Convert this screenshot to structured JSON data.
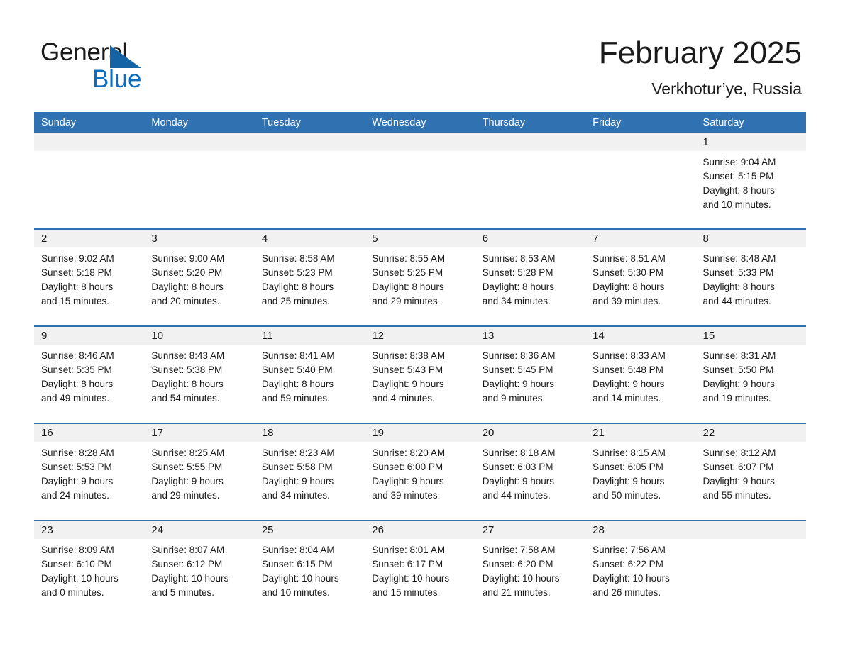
{
  "brand": {
    "name_part1": "General",
    "name_part2": "Blue",
    "triangle_color": "#1464a5",
    "blue_color": "#0d6ebf"
  },
  "header": {
    "title": "February 2025",
    "subtitle": "Verkhotur’ye, Russia",
    "header_bg": "#3072b1",
    "row_border": "#2f70af",
    "number_band_bg": "#f1f1f1"
  },
  "weekdays": [
    {
      "label": "Sunday"
    },
    {
      "label": "Monday"
    },
    {
      "label": "Tuesday"
    },
    {
      "label": "Wednesday"
    },
    {
      "label": "Thursday"
    },
    {
      "label": "Friday"
    },
    {
      "label": "Saturday"
    }
  ],
  "weeks": [
    {
      "days": [
        {
          "num": "",
          "sunrise": "",
          "sunset": "",
          "daylight1": "",
          "daylight2": ""
        },
        {
          "num": "",
          "sunrise": "",
          "sunset": "",
          "daylight1": "",
          "daylight2": ""
        },
        {
          "num": "",
          "sunrise": "",
          "sunset": "",
          "daylight1": "",
          "daylight2": ""
        },
        {
          "num": "",
          "sunrise": "",
          "sunset": "",
          "daylight1": "",
          "daylight2": ""
        },
        {
          "num": "",
          "sunrise": "",
          "sunset": "",
          "daylight1": "",
          "daylight2": ""
        },
        {
          "num": "",
          "sunrise": "",
          "sunset": "",
          "daylight1": "",
          "daylight2": ""
        },
        {
          "num": "1",
          "sunrise": "Sunrise: 9:04 AM",
          "sunset": "Sunset: 5:15 PM",
          "daylight1": "Daylight: 8 hours",
          "daylight2": "and 10 minutes."
        }
      ]
    },
    {
      "days": [
        {
          "num": "2",
          "sunrise": "Sunrise: 9:02 AM",
          "sunset": "Sunset: 5:18 PM",
          "daylight1": "Daylight: 8 hours",
          "daylight2": "and 15 minutes."
        },
        {
          "num": "3",
          "sunrise": "Sunrise: 9:00 AM",
          "sunset": "Sunset: 5:20 PM",
          "daylight1": "Daylight: 8 hours",
          "daylight2": "and 20 minutes."
        },
        {
          "num": "4",
          "sunrise": "Sunrise: 8:58 AM",
          "sunset": "Sunset: 5:23 PM",
          "daylight1": "Daylight: 8 hours",
          "daylight2": "and 25 minutes."
        },
        {
          "num": "5",
          "sunrise": "Sunrise: 8:55 AM",
          "sunset": "Sunset: 5:25 PM",
          "daylight1": "Daylight: 8 hours",
          "daylight2": "and 29 minutes."
        },
        {
          "num": "6",
          "sunrise": "Sunrise: 8:53 AM",
          "sunset": "Sunset: 5:28 PM",
          "daylight1": "Daylight: 8 hours",
          "daylight2": "and 34 minutes."
        },
        {
          "num": "7",
          "sunrise": "Sunrise: 8:51 AM",
          "sunset": "Sunset: 5:30 PM",
          "daylight1": "Daylight: 8 hours",
          "daylight2": "and 39 minutes."
        },
        {
          "num": "8",
          "sunrise": "Sunrise: 8:48 AM",
          "sunset": "Sunset: 5:33 PM",
          "daylight1": "Daylight: 8 hours",
          "daylight2": "and 44 minutes."
        }
      ]
    },
    {
      "days": [
        {
          "num": "9",
          "sunrise": "Sunrise: 8:46 AM",
          "sunset": "Sunset: 5:35 PM",
          "daylight1": "Daylight: 8 hours",
          "daylight2": "and 49 minutes."
        },
        {
          "num": "10",
          "sunrise": "Sunrise: 8:43 AM",
          "sunset": "Sunset: 5:38 PM",
          "daylight1": "Daylight: 8 hours",
          "daylight2": "and 54 minutes."
        },
        {
          "num": "11",
          "sunrise": "Sunrise: 8:41 AM",
          "sunset": "Sunset: 5:40 PM",
          "daylight1": "Daylight: 8 hours",
          "daylight2": "and 59 minutes."
        },
        {
          "num": "12",
          "sunrise": "Sunrise: 8:38 AM",
          "sunset": "Sunset: 5:43 PM",
          "daylight1": "Daylight: 9 hours",
          "daylight2": "and 4 minutes."
        },
        {
          "num": "13",
          "sunrise": "Sunrise: 8:36 AM",
          "sunset": "Sunset: 5:45 PM",
          "daylight1": "Daylight: 9 hours",
          "daylight2": "and 9 minutes."
        },
        {
          "num": "14",
          "sunrise": "Sunrise: 8:33 AM",
          "sunset": "Sunset: 5:48 PM",
          "daylight1": "Daylight: 9 hours",
          "daylight2": "and 14 minutes."
        },
        {
          "num": "15",
          "sunrise": "Sunrise: 8:31 AM",
          "sunset": "Sunset: 5:50 PM",
          "daylight1": "Daylight: 9 hours",
          "daylight2": "and 19 minutes."
        }
      ]
    },
    {
      "days": [
        {
          "num": "16",
          "sunrise": "Sunrise: 8:28 AM",
          "sunset": "Sunset: 5:53 PM",
          "daylight1": "Daylight: 9 hours",
          "daylight2": "and 24 minutes."
        },
        {
          "num": "17",
          "sunrise": "Sunrise: 8:25 AM",
          "sunset": "Sunset: 5:55 PM",
          "daylight1": "Daylight: 9 hours",
          "daylight2": "and 29 minutes."
        },
        {
          "num": "18",
          "sunrise": "Sunrise: 8:23 AM",
          "sunset": "Sunset: 5:58 PM",
          "daylight1": "Daylight: 9 hours",
          "daylight2": "and 34 minutes."
        },
        {
          "num": "19",
          "sunrise": "Sunrise: 8:20 AM",
          "sunset": "Sunset: 6:00 PM",
          "daylight1": "Daylight: 9 hours",
          "daylight2": "and 39 minutes."
        },
        {
          "num": "20",
          "sunrise": "Sunrise: 8:18 AM",
          "sunset": "Sunset: 6:03 PM",
          "daylight1": "Daylight: 9 hours",
          "daylight2": "and 44 minutes."
        },
        {
          "num": "21",
          "sunrise": "Sunrise: 8:15 AM",
          "sunset": "Sunset: 6:05 PM",
          "daylight1": "Daylight: 9 hours",
          "daylight2": "and 50 minutes."
        },
        {
          "num": "22",
          "sunrise": "Sunrise: 8:12 AM",
          "sunset": "Sunset: 6:07 PM",
          "daylight1": "Daylight: 9 hours",
          "daylight2": "and 55 minutes."
        }
      ]
    },
    {
      "days": [
        {
          "num": "23",
          "sunrise": "Sunrise: 8:09 AM",
          "sunset": "Sunset: 6:10 PM",
          "daylight1": "Daylight: 10 hours",
          "daylight2": "and 0 minutes."
        },
        {
          "num": "24",
          "sunrise": "Sunrise: 8:07 AM",
          "sunset": "Sunset: 6:12 PM",
          "daylight1": "Daylight: 10 hours",
          "daylight2": "and 5 minutes."
        },
        {
          "num": "25",
          "sunrise": "Sunrise: 8:04 AM",
          "sunset": "Sunset: 6:15 PM",
          "daylight1": "Daylight: 10 hours",
          "daylight2": "and 10 minutes."
        },
        {
          "num": "26",
          "sunrise": "Sunrise: 8:01 AM",
          "sunset": "Sunset: 6:17 PM",
          "daylight1": "Daylight: 10 hours",
          "daylight2": "and 15 minutes."
        },
        {
          "num": "27",
          "sunrise": "Sunrise: 7:58 AM",
          "sunset": "Sunset: 6:20 PM",
          "daylight1": "Daylight: 10 hours",
          "daylight2": "and 21 minutes."
        },
        {
          "num": "28",
          "sunrise": "Sunrise: 7:56 AM",
          "sunset": "Sunset: 6:22 PM",
          "daylight1": "Daylight: 10 hours",
          "daylight2": "and 26 minutes."
        },
        {
          "num": "",
          "sunrise": "",
          "sunset": "",
          "daylight1": "",
          "daylight2": ""
        }
      ]
    }
  ]
}
